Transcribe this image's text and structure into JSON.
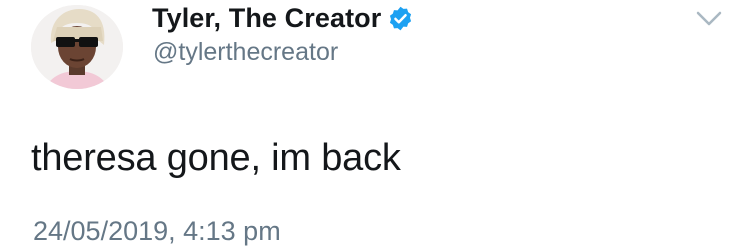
{
  "tweet": {
    "author": {
      "display_name": "Tyler, The Creator",
      "handle": "@tylerthecreator",
      "verified": true,
      "verified_icon": "verified-badge-icon",
      "avatar_icon": "profile-avatar"
    },
    "text": "theresa gone, im back",
    "timestamp": "24/05/2019, 4:13 pm",
    "menu_icon": "chevron-down-icon"
  },
  "colors": {
    "name": "#14171a",
    "secondary": "#657786",
    "verified": "#1da1f2",
    "caret": "#aab8c2"
  }
}
